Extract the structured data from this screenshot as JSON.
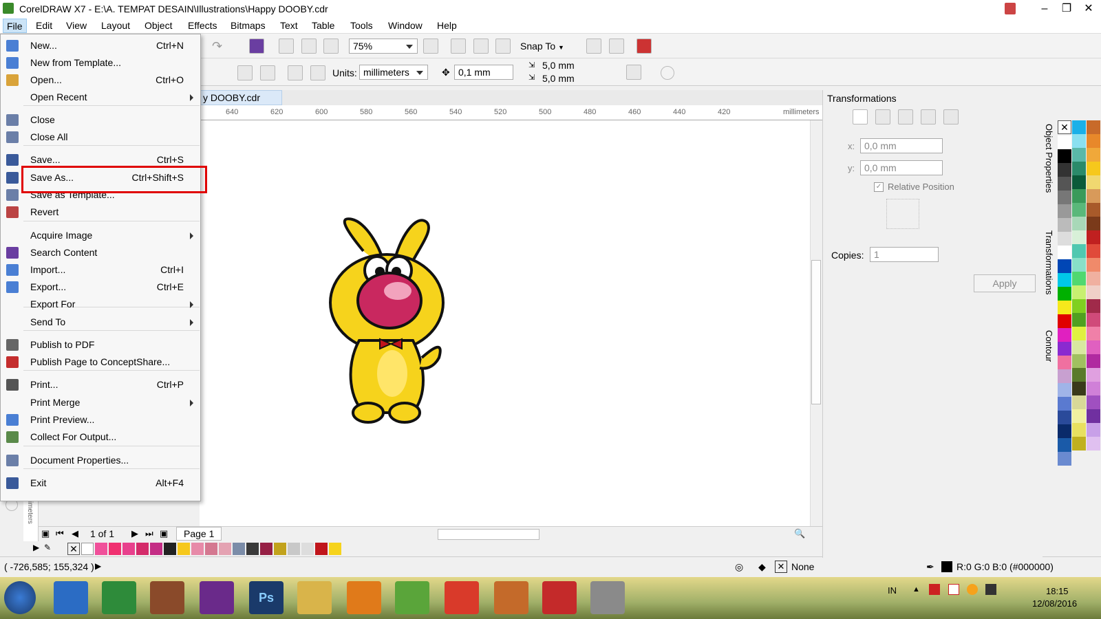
{
  "window": {
    "title": "CorelDRAW X7 - E:\\A. TEMPAT DESAIN\\Illustrations\\Happy DOOBY.cdr",
    "btn_min": "–",
    "btn_max": "❐",
    "btn_close": "✕"
  },
  "menubar": [
    "File",
    "Edit",
    "View",
    "Layout",
    "Object",
    "Effects",
    "Bitmaps",
    "Text",
    "Table",
    "Tools",
    "Window",
    "Help"
  ],
  "toolbar": {
    "zoom": "75%",
    "snap_to": "Snap To",
    "units_label": "Units:",
    "units_value": "millimeters",
    "nudge": "0,1 mm",
    "dup_x": "5,0 mm",
    "dup_y": "5,0 mm"
  },
  "doc_tab": "y DOOBY.cdr",
  "ruler": {
    "ticks": [
      "640",
      "620",
      "600",
      "580",
      "560",
      "540",
      "520",
      "500",
      "480",
      "460",
      "440",
      "420"
    ],
    "unit": "millimeters",
    "v_unit": "millimeters"
  },
  "file_menu": {
    "items": [
      {
        "label": "New...",
        "shortcut": "Ctrl+N",
        "icon": "new-icon"
      },
      {
        "label": "New from Template...",
        "shortcut": "",
        "icon": "template-icon"
      },
      {
        "label": "Open...",
        "shortcut": "Ctrl+O",
        "icon": "open-folder-icon"
      },
      {
        "label": "Open Recent",
        "shortcut": "",
        "icon": "",
        "submenu": true
      },
      {
        "label": "Close",
        "shortcut": "",
        "icon": "close-doc-icon"
      },
      {
        "label": "Close All",
        "shortcut": "",
        "icon": "close-all-icon"
      },
      {
        "label": "Save...",
        "shortcut": "Ctrl+S",
        "icon": "save-icon"
      },
      {
        "label": "Save As...",
        "shortcut": "Ctrl+Shift+S",
        "icon": "save-as-icon"
      },
      {
        "label": "Save as Template...",
        "shortcut": "",
        "icon": "save-template-icon"
      },
      {
        "label": "Revert",
        "shortcut": "",
        "icon": "revert-icon"
      },
      {
        "label": "Acquire Image",
        "shortcut": "",
        "icon": "",
        "submenu": true
      },
      {
        "label": "Search Content",
        "shortcut": "",
        "icon": "search-content-icon"
      },
      {
        "label": "Import...",
        "shortcut": "Ctrl+I",
        "icon": "import-icon"
      },
      {
        "label": "Export...",
        "shortcut": "Ctrl+E",
        "icon": "export-icon"
      },
      {
        "label": "Export For",
        "shortcut": "",
        "icon": "",
        "submenu": true
      },
      {
        "label": "Send To",
        "shortcut": "",
        "icon": "",
        "submenu": true
      },
      {
        "label": "Publish to PDF",
        "shortcut": "",
        "icon": "pdf-icon"
      },
      {
        "label": "Publish Page to ConceptShare...",
        "shortcut": "",
        "icon": "conceptshare-icon"
      },
      {
        "label": "Print...",
        "shortcut": "Ctrl+P",
        "icon": "print-icon"
      },
      {
        "label": "Print Merge",
        "shortcut": "",
        "icon": "",
        "submenu": true
      },
      {
        "label": "Print Preview...",
        "shortcut": "",
        "icon": "print-preview-icon"
      },
      {
        "label": "Collect For Output...",
        "shortcut": "",
        "icon": "collect-output-icon"
      },
      {
        "label": "Document Properties...",
        "shortcut": "",
        "icon": "doc-properties-icon"
      },
      {
        "label": "Exit",
        "shortcut": "Alt+F4",
        "icon": "exit-icon"
      }
    ]
  },
  "docker": {
    "title": "Transformations",
    "x_label": "x:",
    "x_value": "0,0 mm",
    "y_label": "y:",
    "y_value": "0,0 mm",
    "relative": "Relative Position",
    "copies_label": "Copies:",
    "copies_value": "1",
    "apply": "Apply"
  },
  "docker_tabs": [
    "Object Properties",
    "Transformations",
    "Contour"
  ],
  "pager": {
    "count": "1 of 1",
    "page_tab": "Page 1"
  },
  "status": {
    "coords": "( -726,585; 155,324 )",
    "fill": "None",
    "outline": "R:0 G:0 B:0 (#000000)"
  },
  "taskbar": {
    "lang": "IN",
    "time": "18:15",
    "date": "12/08/2016",
    "ps": "Ps"
  },
  "colors": {
    "accent": "#cce4f7",
    "highlight_red": "#e00000",
    "menu_bg": "#f7f7f7"
  }
}
